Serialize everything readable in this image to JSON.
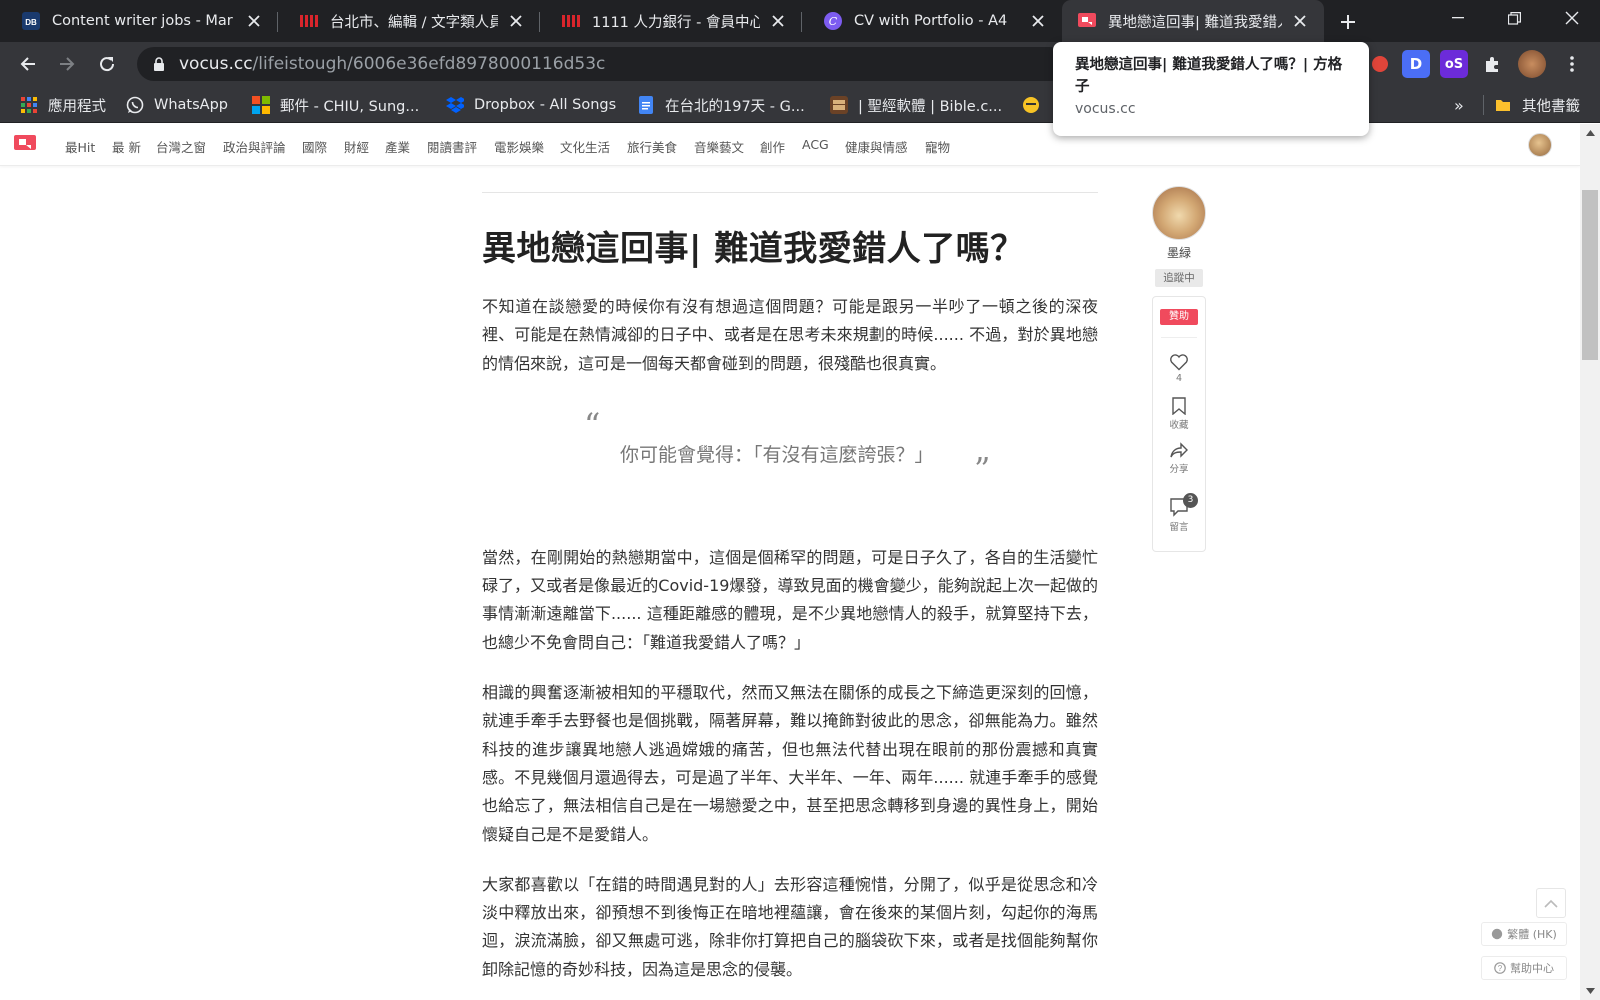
{
  "browser": {
    "tabs": [
      {
        "title": "Content writer jobs - Mar",
        "favicon": "db-icon"
      },
      {
        "title": "台北市、編輯 / 文字類人員",
        "favicon": "job-bank-icon"
      },
      {
        "title": "1111 人力銀行 - 會員中心 -",
        "favicon": "job-bank-icon"
      },
      {
        "title": "CV with Portfolio - A4",
        "favicon": "canva-icon"
      },
      {
        "title": "異地戀這回事| 難道我愛錯人了嗎？",
        "favicon": "vocus-icon"
      }
    ],
    "url_host": "vocus.cc",
    "url_path": "/lifeistough/6006e36efd8978000116d53c",
    "hover_card": {
      "title": "異地戀這回事| 難道我愛錯人了嗎？| 方格子",
      "host": "vocus.cc"
    },
    "bookmarks": [
      {
        "label": "應用程式",
        "icon": "apps-grid-icon"
      },
      {
        "label": "WhatsApp",
        "icon": "whatsapp-icon"
      },
      {
        "label": "郵件 - CHIU, Sung...",
        "icon": "microsoft-icon"
      },
      {
        "label": "Dropbox - All Songs",
        "icon": "dropbox-icon"
      },
      {
        "label": "在台北的197天 - G...",
        "icon": "docs-icon"
      },
      {
        "label": "| 聖經軟體 | Bible.c...",
        "icon": "bible-icon"
      }
    ],
    "bookmarks_overflow": "»",
    "other_bookmarks": "其他書籤",
    "extensions": [
      {
        "name": "d-extension-icon",
        "letter": "D"
      },
      {
        "name": "os-extension-icon",
        "letter": "oS"
      }
    ]
  },
  "site": {
    "nav": [
      "最Hit",
      "最 新",
      "台灣之窗",
      "政治與評論",
      "國際",
      "財經",
      "產業",
      "閱讀書評",
      "電影娛樂",
      "文化生活",
      "旅行美食",
      "音樂藝文",
      "創作",
      "ACG",
      "健康與情感",
      "寵物"
    ]
  },
  "article": {
    "title": "異地戀這回事| 難道我愛錯人了嗎？",
    "p1": "不知道在談戀愛的時候你有沒有想過這個問題？可能是跟另一半吵了一頓之後的深夜裡、可能是在熱情減卻的日子中、或者是在思考未來規劃的時候...... 不過，對於異地戀的情侶來說，這可是一個每天都會碰到的問題，很殘酷也很真實。",
    "quote_open": "“",
    "quote": "你可能會覺得：「有沒有這麼誇張？」",
    "quote_close": "”",
    "p2": "當然，在剛開始的熱戀期當中，這個是個稀罕的問題，可是日子久了，各自的生活變忙碌了，又或者是像最近的Covid-19爆發，導致見面的機會變少，能夠說起上次一起做的事情漸漸遠離當下...... 這種距離感的體現，是不少異地戀情人的殺手，就算堅持下去，也總少不免會問自己：「難道我愛錯人了嗎？」",
    "p3": "相識的興奮逐漸被相知的平穩取代，然而又無法在關係的成長之下締造更深刻的回憶，就連手牽手去野餐也是個挑戰，隔著屏幕，難以掩飾對彼此的思念，卻無能為力。雖然科技的進步讓異地戀人逃過嫦娥的痛苦，但也無法代替出現在眼前的那份震撼和真實感。不見幾個月還過得去，可是過了半年、大半年、一年、兩年...... 就連手牽手的感覺也給忘了，無法相信自己是在一場戀愛之中，甚至把思念轉移到身邊的異性身上，開始懷疑自己是不是愛錯人。",
    "p4": "大家都喜歡以「在錯的時間遇見對的人」去形容這種惋惜，分開了，似乎是從思念和冷淡中釋放出來，卻預想不到後悔正在暗地裡蘊讓，會在後來的某個片刻，勾起你的海馬迴，淚流滿臉，卻又無處可逃，除非你打算把自己的腦袋砍下來，或者是找個能夠幫你卸除記憶的奇妙科技，因為這是思念的侵襲。"
  },
  "author": {
    "name": "墨緑",
    "follow_status": "追蹤中",
    "sponsor_label": "贊助",
    "like_count": "4",
    "bookmark_label": "收藏",
    "share_label": "分享",
    "comment_count": "3",
    "comment_label": "留言"
  },
  "floating": {
    "language": "繁體 (HK)",
    "help": "幫助中心"
  },
  "colors": {
    "brand": "#f04a5d",
    "chrome_dark": "#202124",
    "chrome_toolbar": "#35363a"
  }
}
